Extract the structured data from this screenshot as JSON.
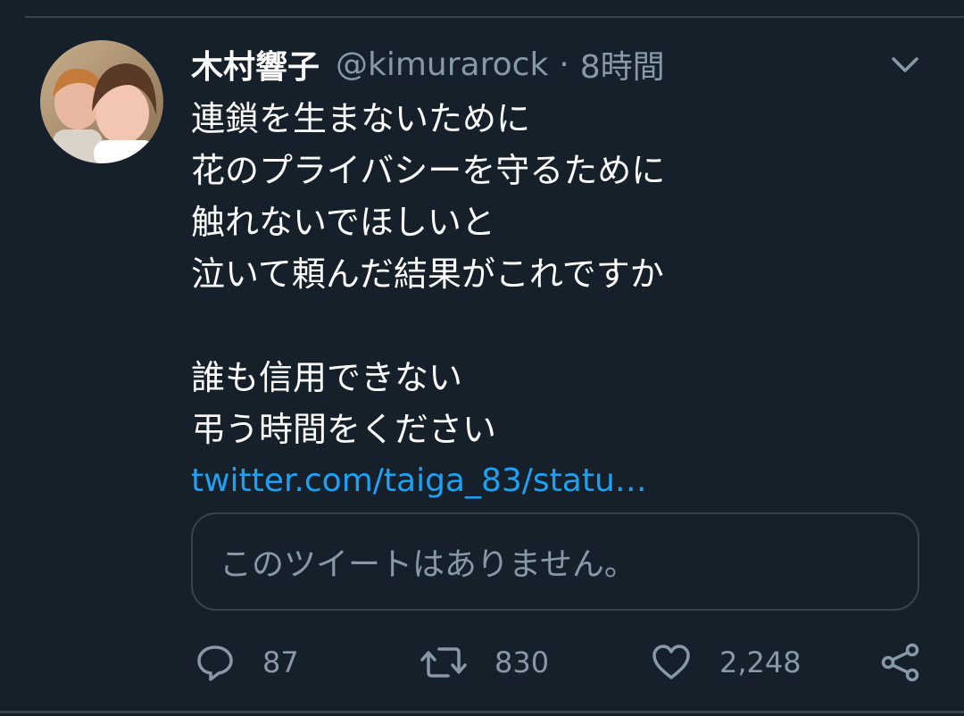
{
  "tweet": {
    "display_name": "木村響子",
    "handle": "@kimurarock",
    "separator": "·",
    "time": "8時間",
    "lines": [
      "連鎖を生まないために",
      "花のプライバシーを守るために",
      "触れないでほしいと",
      "泣いて頼んだ結果がこれですか",
      "",
      "誰も信用できない",
      "弔う時間をください"
    ],
    "link_text": "twitter.com/taiga_83/statu…",
    "quoted_unavailable": "このツイートはありません。"
  },
  "actions": {
    "reply_count": "87",
    "retweet_count": "830",
    "like_count": "2,248"
  },
  "icons": {
    "reply": "reply-icon",
    "retweet": "retweet-icon",
    "like": "heart-icon",
    "share": "share-icon",
    "more": "chevron-down-icon"
  },
  "colors": {
    "background": "#15202b",
    "text": "#ffffff",
    "muted": "#8899a6",
    "link": "#1da1f2",
    "border": "#38444d"
  }
}
